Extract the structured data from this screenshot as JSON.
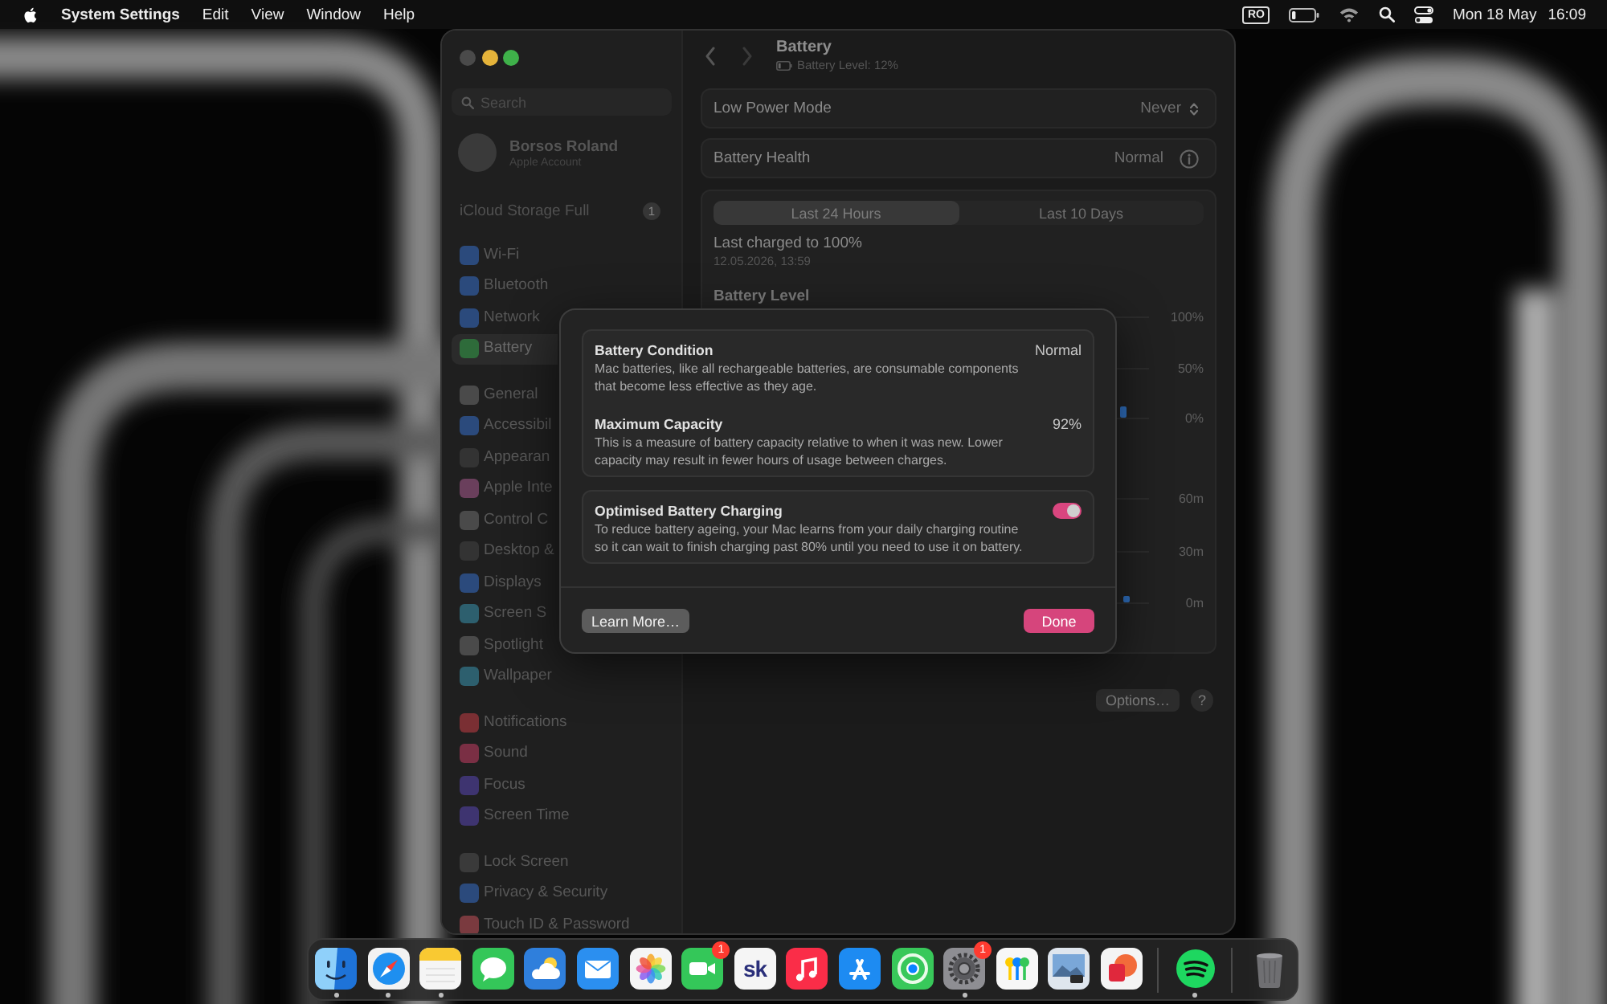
{
  "menu_bar": {
    "app_name": "System Settings",
    "menus": [
      "Edit",
      "View",
      "Window",
      "Help"
    ],
    "input_source": "RO",
    "date": "Mon 18 May",
    "time": "16:09"
  },
  "window": {
    "sidebar": {
      "search": {
        "placeholder": "Search"
      },
      "account": {
        "name": "Borsos Roland",
        "subtitle": "Apple Account"
      },
      "storage_alert": {
        "label": "iCloud Storage Full",
        "badge": "1"
      },
      "groups": [
        {
          "items": [
            {
              "label": "Wi-Fi",
              "selected": false,
              "color": "#2b4a7c"
            },
            {
              "label": "Bluetooth",
              "selected": false,
              "color": "#2b4a7c"
            },
            {
              "label": "Network",
              "selected": false,
              "color": "#2b4a7c"
            },
            {
              "label": "Battery",
              "selected": true,
              "color": "#2e6b3a"
            }
          ]
        },
        {
          "items": [
            {
              "label": "General",
              "selected": false,
              "color": "#4a4a4a"
            },
            {
              "label": "Accessibil",
              "selected": false,
              "color": "#2b4a7c"
            },
            {
              "label": "Appearan",
              "selected": false,
              "color": "#333333"
            },
            {
              "label": "Apple Inte",
              "selected": false,
              "color": "#6a3f5c"
            },
            {
              "label": "Control C",
              "selected": false,
              "color": "#4a4a4a"
            },
            {
              "label": "Desktop &",
              "selected": false,
              "color": "#333333"
            },
            {
              "label": "Displays",
              "selected": false,
              "color": "#2b4a7c"
            },
            {
              "label": "Screen S",
              "selected": false,
              "color": "#2d5f6e"
            },
            {
              "label": "Spotlight",
              "selected": false,
              "color": "#4a4a4a"
            },
            {
              "label": "Wallpaper",
              "selected": false,
              "color": "#2d5f6e"
            }
          ]
        },
        {
          "items": [
            {
              "label": "Notifications",
              "selected": false,
              "color": "#7a2f33"
            },
            {
              "label": "Sound",
              "selected": false,
              "color": "#7a2f44"
            },
            {
              "label": "Focus",
              "selected": false,
              "color": "#3e3470"
            },
            {
              "label": "Screen Time",
              "selected": false,
              "color": "#3e3470"
            }
          ]
        },
        {
          "items": [
            {
              "label": "Lock Screen",
              "selected": false,
              "color": "#3a3a3a"
            },
            {
              "label": "Privacy & Security",
              "selected": false,
              "color": "#2b4a7c"
            },
            {
              "label": "Touch ID & Password",
              "selected": false,
              "color": "#7a3a3f"
            }
          ]
        }
      ]
    },
    "header": {
      "title": "Battery",
      "subtitle": "Battery Level: 12%"
    },
    "settings": [
      {
        "label": "Low Power Mode",
        "value": "Never",
        "kind": "popup"
      },
      {
        "label": "Battery Health",
        "value": "Normal",
        "kind": "info"
      }
    ],
    "usage": {
      "tabs": [
        {
          "label": "Last 24 Hours",
          "selected": true
        },
        {
          "label": "Last 10 Days",
          "selected": false
        }
      ],
      "last_charged": "Last charged to 100%",
      "charged_at": "12.05.2026, 13:59",
      "battery_chart": {
        "title": "Battery Level",
        "y_labels": [
          "100%",
          "50%",
          "0%"
        ]
      },
      "screen_chart": {
        "y_labels": [
          "60m",
          "30m",
          "0m"
        ]
      }
    },
    "options_button": "Options…",
    "help_button": "?"
  },
  "dialog": {
    "sections": [
      {
        "items": [
          {
            "title": "Battery Condition",
            "kind": "value",
            "value": "Normal",
            "description": "Mac batteries, like all rechargeable batteries, are consumable components that become less effective as they age."
          },
          {
            "title": "Maximum Capacity",
            "kind": "value",
            "value": "92%",
            "description": "This is a measure of battery capacity relative to when it was new. Lower capacity may result in fewer hours of usage between charges."
          }
        ]
      },
      {
        "items": [
          {
            "title": "Optimised Battery Charging",
            "kind": "toggle",
            "on": true,
            "description": "To reduce battery ageing, your Mac learns from your daily charging routine so it can wait to finish charging past 80% until you need to use it on battery."
          }
        ]
      }
    ],
    "buttons": [
      {
        "label": "Learn More…",
        "kind": "secondary"
      },
      {
        "label": "Done",
        "kind": "primary"
      }
    ]
  },
  "dock": {
    "sections": [
      {
        "items": [
          {
            "running": true
          },
          {
            "running": true
          },
          {
            "running": true
          },
          {
            "running": false
          },
          {
            "running": false
          },
          {
            "running": false
          },
          {
            "running": false
          },
          {
            "running": false,
            "badge": "1"
          },
          {
            "running": false,
            "label": "sk"
          },
          {
            "running": false
          },
          {
            "running": false
          },
          {
            "running": false
          },
          {
            "running": true,
            "badge": "1"
          },
          {
            "running": false
          },
          {
            "running": false
          },
          {
            "running": false
          }
        ]
      },
      {
        "items": [
          {
            "running": true
          }
        ]
      },
      {
        "items": [
          {
            "running": false
          }
        ]
      }
    ]
  }
}
